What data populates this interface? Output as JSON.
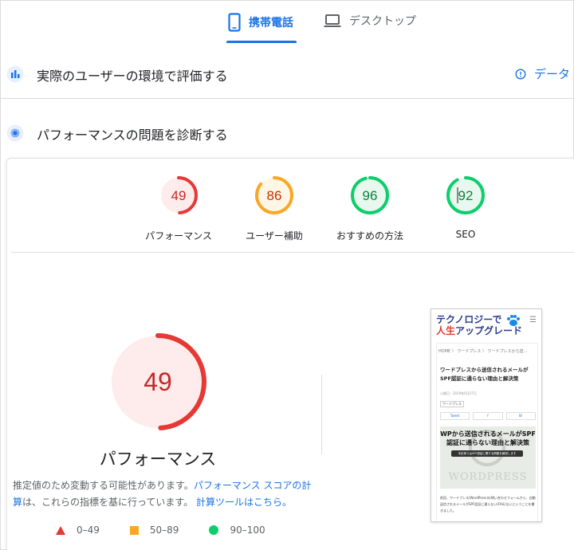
{
  "tabs": [
    {
      "label": "携帯電話",
      "active": true,
      "icon": "smartphone-icon"
    },
    {
      "label": "デスクトップ",
      "active": false,
      "icon": "laptop-icon"
    }
  ],
  "sections": {
    "real_user": {
      "title": "実際のユーザーの環境で評価する",
      "link_label": "データ",
      "link_icon": "info-icon"
    },
    "diagnose": {
      "title": "パフォーマンスの問題を診断する"
    }
  },
  "scores": [
    {
      "value": "49",
      "score": 49,
      "label": "パフォーマンス",
      "status": "fail",
      "color": "#e53935",
      "fill": "#fdeceb"
    },
    {
      "value": "86",
      "score": 86,
      "label": "ユーザー補助",
      "status": "average",
      "color": "#f9a825",
      "fill": "#fff6e6"
    },
    {
      "value": "96",
      "score": 96,
      "label": "おすすめの方法",
      "status": "pass",
      "color": "#0cce6b",
      "fill": "#e8f8ee"
    },
    {
      "value": "92",
      "score": 92,
      "label": "SEO",
      "status": "pass",
      "color": "#0cce6b",
      "fill": "#e8f8ee"
    }
  ],
  "main_score": {
    "value": "49",
    "score": 49,
    "title": "パフォーマンス",
    "color": "#e53935",
    "fill": "#fdeceb"
  },
  "description": {
    "text1": "推定値のため変動する可能性があります。",
    "link1": "パフォーマンス スコアの計算",
    "text2": "は、これらの指標を基に行っています。",
    "link2": "計算ツールはこちら。"
  },
  "legend": [
    {
      "range": "0–49",
      "shape": "triangle",
      "color": "#e53935"
    },
    {
      "range": "50–89",
      "shape": "square",
      "color": "#f9a825"
    },
    {
      "range": "90–100",
      "shape": "circle",
      "color": "#0cce6b"
    }
  ],
  "screenshot": {
    "site_title_line1": "テクノロジーで",
    "site_title_red": "人生",
    "site_title_line2": "アップグレード",
    "breadcrumb": "HOME 〉 ワードプレス 〉 ワードプレスから送...",
    "article_title": "ワードプレスから送信されるメールがSPF認証に通らない理由と解決策",
    "meta": "公開日：2019年6月27日",
    "tag": "ワードプレス",
    "share": [
      "Tweet",
      "f",
      "B!"
    ],
    "hero_caption": "WPから送信されるメールがSPF認証に通らない理由と解決策",
    "hero_pill": "本記事ではSPF認証に関する問題を解説します",
    "hero_watermark": "WORDPRESS",
    "excerpt": "前回、ワードプレス(WordPress)の問い合わせフォームから、自動返信されるメールがSPF認証に通らない(FAIL)ないということを書きました。"
  }
}
